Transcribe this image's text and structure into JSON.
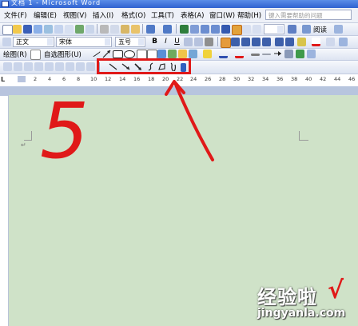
{
  "titlebar": {
    "title": "文档 1 - Microsoft Word"
  },
  "menubar": {
    "items": [
      "文件(F)",
      "编辑(E)",
      "视图(V)",
      "插入(I)",
      "格式(O)",
      "工具(T)",
      "表格(A)",
      "窗口(W)",
      "帮助(H)"
    ],
    "help_placeholder": "键入需要帮助的问题"
  },
  "standard_toolbar": {
    "read_label": "阅读"
  },
  "formatting_toolbar": {
    "style": "正文",
    "font": "宋体",
    "size": "五号",
    "bold": "B",
    "italic": "I",
    "underline": "U"
  },
  "drawing_toolbar": {
    "draw_label": "绘图(R)",
    "autoshapes_label": "自选图形(U)"
  },
  "ruler": {
    "marks": [
      "L",
      "2",
      "4",
      "6",
      "8",
      "10",
      "12",
      "14",
      "16",
      "18",
      "20",
      "22",
      "24",
      "26",
      "28",
      "30",
      "32",
      "34",
      "36",
      "38",
      "40",
      "42",
      "44",
      "46"
    ]
  },
  "annotation": {
    "number": "5"
  },
  "watermark": {
    "title": "经验啦",
    "url": "jingyanla.com",
    "check": "√"
  },
  "colors": {
    "accent_red": "#e01919",
    "page_bg": "#cfe2c8",
    "toolbar_bg": "#dde4f2"
  }
}
